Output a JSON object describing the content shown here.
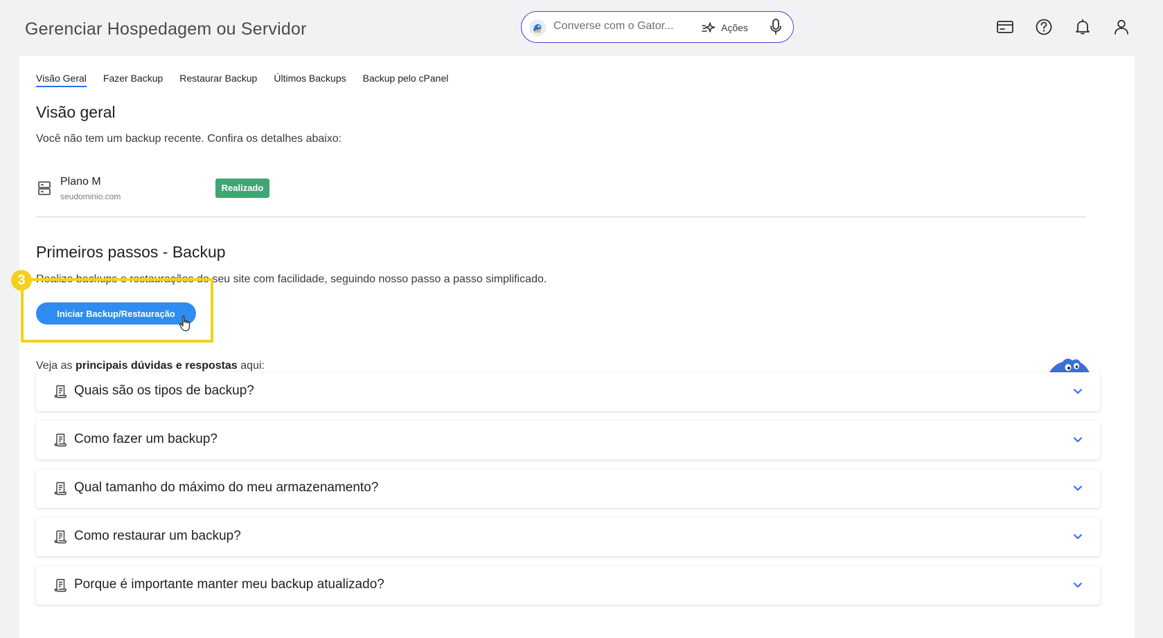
{
  "header": {
    "title": "Gerenciar Hospedagem ou Servidor",
    "chat_placeholder": "Converse com o Gator...",
    "actions_label": "Ações",
    "icons": [
      "card-icon",
      "help-icon",
      "bell-icon",
      "user-icon"
    ]
  },
  "tabs": [
    {
      "label": "Visão Geral",
      "active": true
    },
    {
      "label": "Fazer Backup",
      "active": false
    },
    {
      "label": "Restaurar Backup",
      "active": false
    },
    {
      "label": "Últimos Backups",
      "active": false
    },
    {
      "label": "Backup pelo cPanel",
      "active": false
    }
  ],
  "overview": {
    "title": "Visão geral",
    "subtitle": "Você não tem um backup recente. Confira os detalhes abaixo:",
    "plan": {
      "name": "Plano M",
      "domain": "seudominio.com",
      "status": "Realizado"
    }
  },
  "first_steps": {
    "title": "Primeiros passos - Backup",
    "description": "Realize backups e restaurações do seu site com facilidade, seguindo nosso passo a passo simplificado.",
    "step_number": "3",
    "cta_label": "Iniciar Backup/Restauração"
  },
  "faq": {
    "intro_prefix": "Veja as",
    "intro_bold": "principais dúvidas e respostas",
    "intro_suffix": "aqui:",
    "items": [
      "Quais são os tipos de backup?",
      "Como fazer um backup?",
      "Qual tamanho do máximo do meu armazenamento?",
      "Como restaurar um backup?",
      "Porque é importante manter meu backup atualizado?"
    ]
  },
  "colors": {
    "accent": "#2f8cf0",
    "tab_underline": "#2b6cf6",
    "chat_border": "#3a4bd1",
    "success": "#3fa573",
    "highlight": "#f2d11a",
    "background": "#f2f2f4"
  }
}
